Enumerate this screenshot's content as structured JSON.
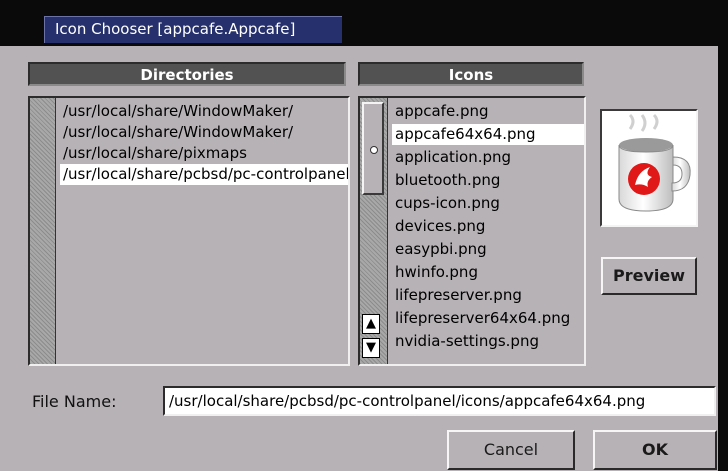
{
  "window": {
    "title": "Icon Chooser [appcafe.Appcafe]"
  },
  "directories": {
    "header": "Directories",
    "items": [
      "/usr/local/share/WindowMaker/",
      "/usr/local/share/WindowMaker/",
      "/usr/local/share/pixmaps",
      "/usr/local/share/pcbsd/pc-controlpanel/icons"
    ],
    "selected_index": 3
  },
  "icons": {
    "header": "Icons",
    "items": [
      "appcafe.png",
      "appcafe64x64.png",
      "application.png",
      "bluetooth.png",
      "cups-icon.png",
      "devices.png",
      "easypbi.png",
      "hwinfo.png",
      "lifepreserver.png",
      "lifepreserver64x64.png",
      "nvidia-settings.png"
    ],
    "selected_index": 1,
    "scroll_up_icon": "triangle-up-icon",
    "scroll_down_icon": "triangle-down-icon"
  },
  "preview": {
    "button_label": "Preview",
    "icon": "appcafe-mug-icon"
  },
  "file_name": {
    "label": "File Name:",
    "value": "/usr/local/share/pcbsd/pc-controlpanel/icons/appcafe64x64.png"
  },
  "buttons": {
    "cancel": "Cancel",
    "ok": "OK"
  },
  "colors": {
    "title_bg": "#25306c",
    "window_bg": "#b6b2b6",
    "header_bg": "#525252"
  }
}
